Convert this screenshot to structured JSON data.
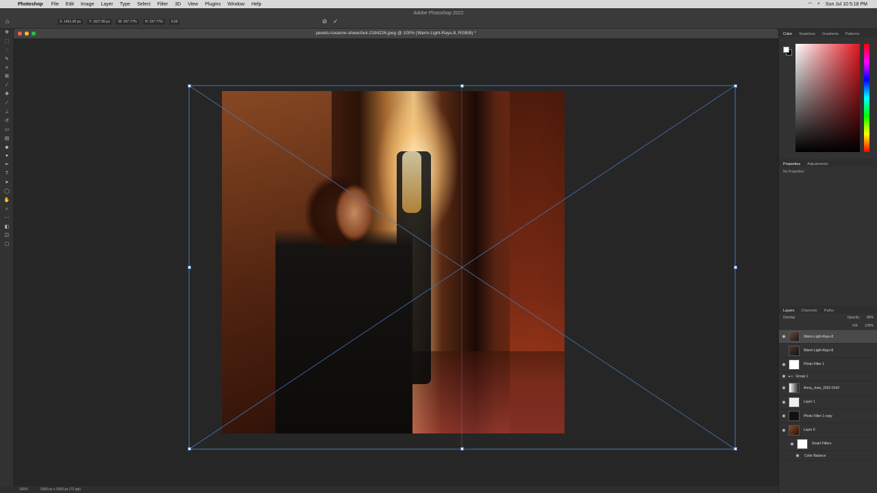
{
  "menubar": {
    "app_name": "Photoshop",
    "items": [
      "File",
      "Edit",
      "Image",
      "Layer",
      "Type",
      "Select",
      "Filter",
      "3D",
      "View",
      "Plugins",
      "Window",
      "Help"
    ],
    "clock": "Sun Jul 10  5:18 PM"
  },
  "window": {
    "app_title": "Adobe Photoshop 2022"
  },
  "options": {
    "x": "X: 1401.00 px",
    "y": "Y: 1027.89 px",
    "w": "W: 197.77%",
    "h": "H: 197.77%",
    "angle": "0.00",
    "cancel_icon": "cancel-icon",
    "commit_icon": "commit-check-icon"
  },
  "document": {
    "tab_title": "pexels-roxanne-shewchuk-2184226.jpeg @ 100% (Warm-Light-Rays-8, RGB/8) *"
  },
  "color_panel": {
    "tabs": [
      "Color",
      "Swatches",
      "Gradients",
      "Patterns"
    ],
    "active_tab": "Color"
  },
  "properties_panel": {
    "tabs": [
      "Properties",
      "Adjustments"
    ],
    "content": "No Properties"
  },
  "layers_panel": {
    "tabs": [
      "Layers",
      "Channels",
      "Paths"
    ],
    "blend_mode": "Overlay",
    "opacity_label": "Opacity:",
    "opacity": "89%",
    "fill_label": "Fill:",
    "fill": "100%",
    "layers": [
      {
        "name": "Warm-Light-Rays-8",
        "selected": true
      },
      {
        "name": "Warm-Light-Rays-8",
        "selected": false
      },
      {
        "name": "Photo Filter 1",
        "selected": false
      },
      {
        "name": "Group 1",
        "selected": false
      },
      {
        "name": "Anna_June_2022-0142",
        "selected": false
      },
      {
        "name": "Layer 1",
        "selected": false
      },
      {
        "name": "Photo Filter 1 copy",
        "selected": false
      },
      {
        "name": "Layer 0",
        "selected": false
      },
      {
        "name": "Smart Filters",
        "selected": false
      },
      {
        "name": "Color Balance",
        "selected": false
      }
    ]
  },
  "status": {
    "zoom": "100%",
    "doc_info": "2000 px x 2000 px (72 ppi)"
  },
  "colors": {
    "accent": "#4a7ab8",
    "panel_bg": "#323232",
    "canvas_bg": "#282828"
  }
}
